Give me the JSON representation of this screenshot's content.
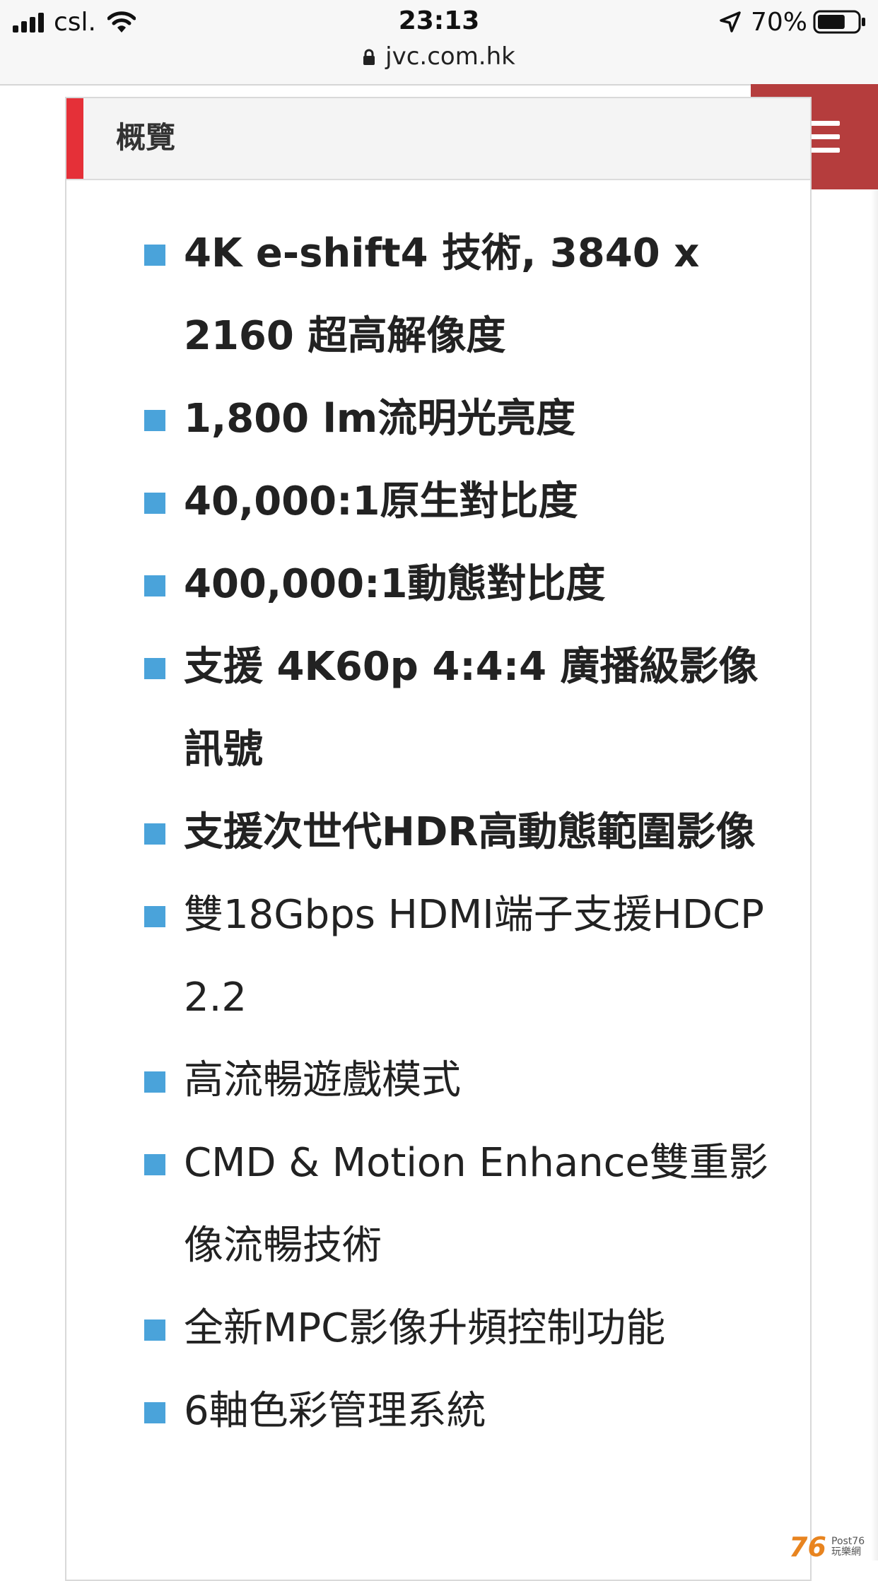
{
  "status_bar": {
    "carrier": "csl.",
    "time": "23:13",
    "battery": "70%",
    "battery_level": 0.7,
    "icons": [
      "signal-icon",
      "wifi-icon",
      "location-arrow-icon",
      "battery-icon"
    ]
  },
  "browser": {
    "url": "jvc.com.hk",
    "lock_icon": "lock-icon"
  },
  "section": {
    "title": "概覽",
    "accent_color": "#e53038"
  },
  "menu": {
    "icon": "hamburger-menu-icon",
    "color": "#b53d3d"
  },
  "features": {
    "bullet_color": "#4aa3da",
    "items": [
      "4K e-shift4 技術, 3840 x 2160 超高解像度",
      "1,800 lm流明光亮度",
      "40,000:1原生對比度",
      "400,000:1動態對比度",
      "支援 4K60p 4:4:4 廣播級影像訊號",
      "支援次世代HDR高動態範圍影像",
      "雙18Gbps HDMI端子支援HDCP 2.2",
      "高流暢遊戲模式",
      "CMD & Motion Enhance雙重影像流暢技術",
      "全新MPC影像升頻控制功能",
      "6軸色彩管理系統"
    ]
  },
  "watermark": {
    "number": "76",
    "text": "Post76 玩樂網"
  }
}
